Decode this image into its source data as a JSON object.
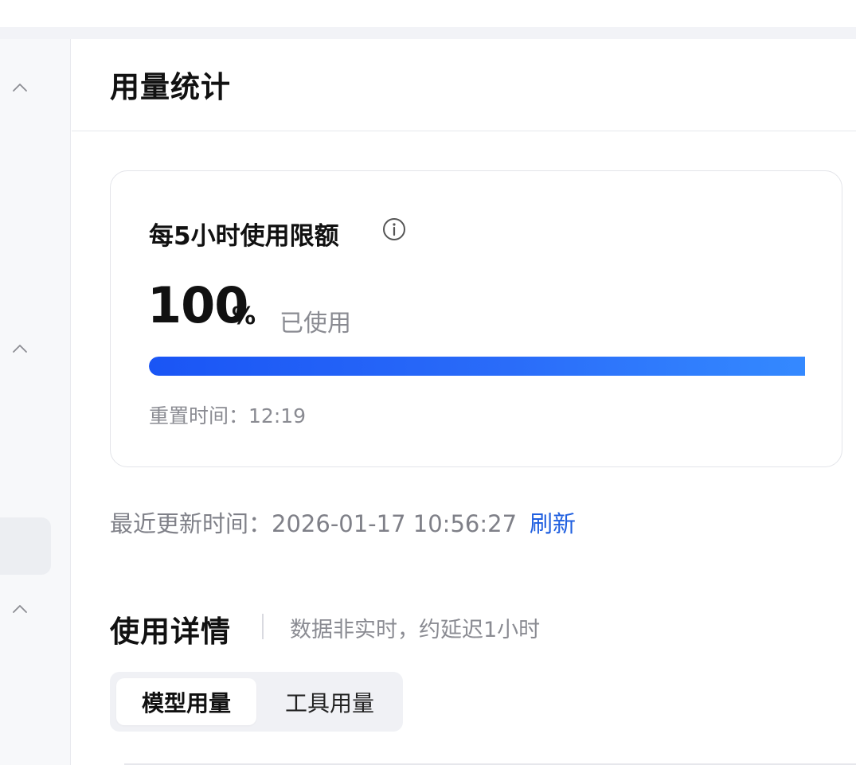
{
  "page": {
    "title": "用量统计"
  },
  "sidebar": {
    "chevrons": [
      "chevron-up-icon",
      "chevron-up-icon",
      "chevron-up-icon"
    ]
  },
  "quota_card": {
    "title": "每5小时使用限额",
    "info_icon": "info-circle-icon",
    "usage_value": "100",
    "usage_unit": "%",
    "usage_label": "已使用",
    "progress_fraction": 1.0,
    "reset_label": "重置时间：",
    "reset_time": "12:19"
  },
  "update": {
    "label": "最近更新时间：",
    "timestamp": "2026-01-17 10:56:27",
    "refresh_label": "刷新"
  },
  "details": {
    "title": "使用详情",
    "note": "数据非实时，约延迟1小时",
    "tabs": [
      {
        "label": "模型用量",
        "active": true
      },
      {
        "label": "工具用量",
        "active": false
      }
    ]
  },
  "colors": {
    "accent": "#1a55f5",
    "accent_end": "#3489ff",
    "link": "#1f5fe0",
    "muted_text": "#8a8b92"
  }
}
